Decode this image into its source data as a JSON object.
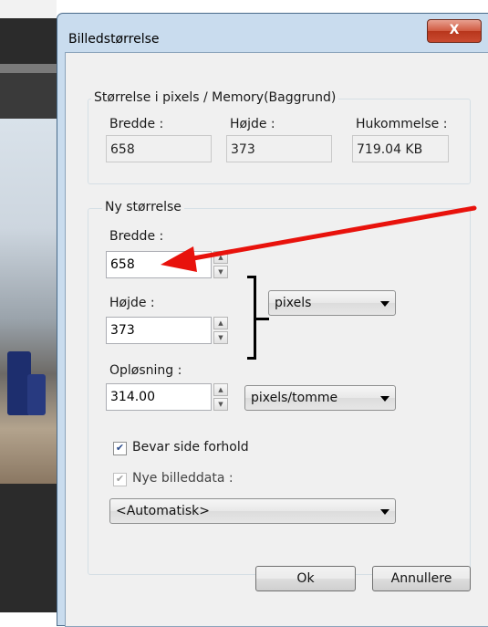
{
  "window": {
    "title": "Billedstørrelse",
    "close_glyph": "X"
  },
  "current_size": {
    "group_label": "Størrelse i pixels / Memory(Baggrund)",
    "width_label": "Bredde :",
    "width_value": "658",
    "height_label": "Højde :",
    "height_value": "373",
    "memory_label": "Hukommelse :",
    "memory_value": "719.04 KB"
  },
  "new_size": {
    "group_label": "Ny størrelse",
    "width_label": "Bredde :",
    "width_value": "658",
    "height_label": "Højde :",
    "height_value": "373",
    "unit_selected": "pixels",
    "resolution_label": "Opløsning :",
    "resolution_value": "314.00",
    "resolution_unit_selected": "pixels/tomme",
    "keep_ratio_label": "Bevar side forhold",
    "keep_ratio_checked": true,
    "new_data_label": "Nye billeddata :",
    "new_data_checked": true,
    "new_data_selected": "<Automatisk>"
  },
  "buttons": {
    "ok": "Ok",
    "cancel": "Annullere"
  },
  "annotation": {
    "arrow_color": "#e8120c"
  },
  "colors": {
    "titlebar": "#c9dcee",
    "close_button": "#c94a30"
  }
}
